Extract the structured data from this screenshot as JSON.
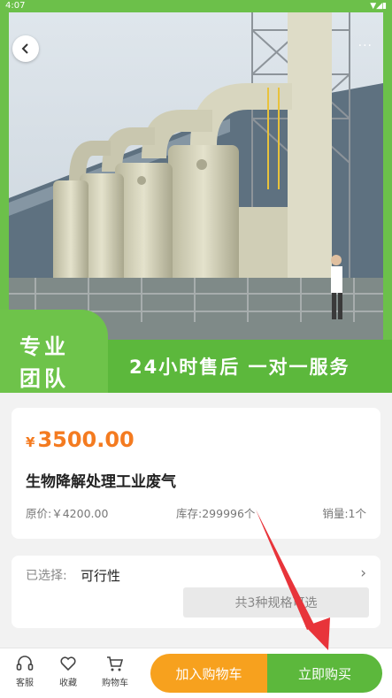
{
  "status": {
    "time": "4:07"
  },
  "hero": {
    "badge_line1": "专业",
    "badge_line2": "团队",
    "slogan": "24小时售后 一对一服务",
    "more": "···"
  },
  "product": {
    "currency": "¥",
    "price": "3500.00",
    "title": "生物降解处理工业废气",
    "original_price": "原价:￥4200.00",
    "stock": "库存:299996个",
    "sales": "销量:1个"
  },
  "spec": {
    "label": "已选择:",
    "value": "可行性",
    "choose_button": "共3种规格可选",
    "arrow": "›"
  },
  "bottom_bar": {
    "service_label": "客服",
    "favorite_label": "收藏",
    "cart_label": "购物车",
    "add_to_cart": "加入购物车",
    "buy_now": "立即购买"
  },
  "colors": {
    "brand_green": "#5cb83c",
    "price_orange": "#f47b20",
    "cart_button": "#f7a11e",
    "annotation_arrow": "#e8343a"
  },
  "icons": [
    "back-icon",
    "headset-icon",
    "heart-icon",
    "cart-icon"
  ]
}
